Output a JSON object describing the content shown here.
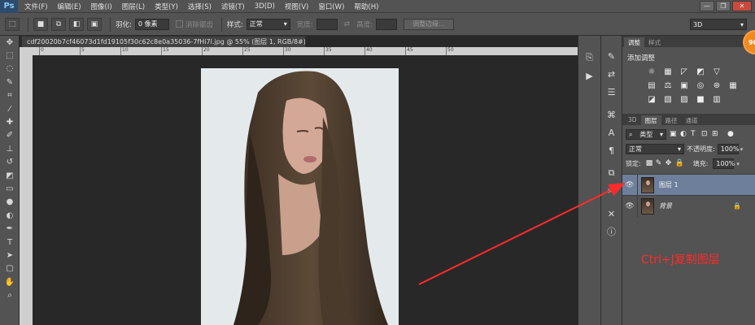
{
  "app": {
    "logo": "Ps"
  },
  "menu": [
    "文件(F)",
    "编辑(E)",
    "图像(I)",
    "图层(L)",
    "类型(Y)",
    "选择(S)",
    "滤镜(T)",
    "3D(D)",
    "视图(V)",
    "窗口(W)",
    "帮助(H)"
  ],
  "window": {
    "minimize": "—",
    "restore": "❐",
    "close": "✕"
  },
  "options": {
    "feather_label": "羽化:",
    "feather_value": "0 像素",
    "antialias_label": "消除锯齿",
    "style_label": "样式:",
    "style_value": "正常",
    "width_label": "宽度:",
    "height_label": "高度:",
    "refine_edge_button": "调整边缘...",
    "workspace": "3D"
  },
  "document": {
    "tab_title": "cdf20020b7cf46073d1fd19105f30c62c8e0a35036-7fHi7l.jpg @ 55% (图层 1, RGB/8#) *",
    "tab_close": "×",
    "ruler_labels": [
      "0",
      "5",
      "10",
      "15",
      "20",
      "25",
      "30",
      "35",
      "40",
      "45",
      "50"
    ]
  },
  "panels": {
    "top_tabs": [
      "调整",
      "样式"
    ],
    "adjustments_title": "添加调整",
    "layer_tabs": [
      "3D",
      "图层",
      "路径",
      "通道"
    ],
    "filter_kind": "类型",
    "blend_mode": "正常",
    "opacity_label": "不透明度:",
    "opacity_value": "100%",
    "lock_label": "锁定:",
    "fill_label": "填充:",
    "fill_value": "100%"
  },
  "layers": [
    {
      "name": "图层 1",
      "selected": true
    },
    {
      "name": "背景",
      "selected": false,
      "locked": true
    }
  ],
  "annotation": {
    "text": "Ctrl+J复制图层",
    "color": "#ff2a2a"
  },
  "badge": {
    "text": "90"
  },
  "colors": {
    "ui_panel": "#535353",
    "canvas_bg": "#282828",
    "selected_layer": "#6e7f9c",
    "annotation": "#ff2a2a"
  }
}
